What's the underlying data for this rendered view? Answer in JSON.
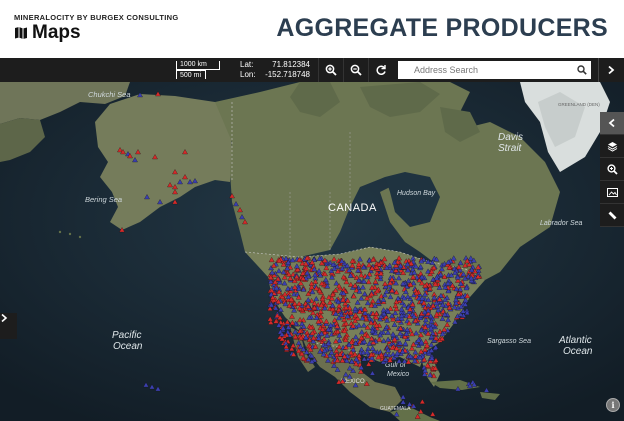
{
  "header": {
    "brand_sub": "MINERALOCITY BY BURGEX CONSULTING",
    "brand_main": "Maps",
    "title": "AGGREGATE PRODUCERS"
  },
  "toolbar": {
    "scale_km": "1000 km",
    "scale_mi": "500 mi",
    "lat_label": "Lat:",
    "lat_value": "71.812384",
    "lon_label": "Lon:",
    "lon_value": "-152.718748",
    "search_placeholder": "Address Search",
    "icons": [
      "zoom-in-icon",
      "zoom-out-icon",
      "refresh-icon",
      "search-icon",
      "chevron-right-icon"
    ]
  },
  "map_labels": {
    "chukchi_sea": "Chukchi Sea",
    "bering_sea": "Bering Sea",
    "canada": "CANADA",
    "hudson_bay": "Hudson Bay",
    "davis": "Davis",
    "strait": "Strait",
    "labrador_sea": "Labrador Sea",
    "pacific": "Pacific",
    "pacific_ocean": "Ocean",
    "atlantic": "Atlantic",
    "atlantic_ocean": "Ocean",
    "sargasso_sea": "Sargasso Sea",
    "gulf_of": "Gulf of",
    "mexico_gulf": "Mexico",
    "mexico": "MEXICO",
    "guatemala": "GUATEMALA",
    "greenland": "GREENLAND (DEN)"
  },
  "markers": {
    "red_color": "#d62a2a",
    "blue_color": "#3b3fb0"
  },
  "side_tools": [
    "chevron-left-icon",
    "layers-icon",
    "zoom-region-icon",
    "image-icon",
    "ruler-icon"
  ],
  "left_tab_icon": "chevron-right-icon",
  "info_label": "i"
}
